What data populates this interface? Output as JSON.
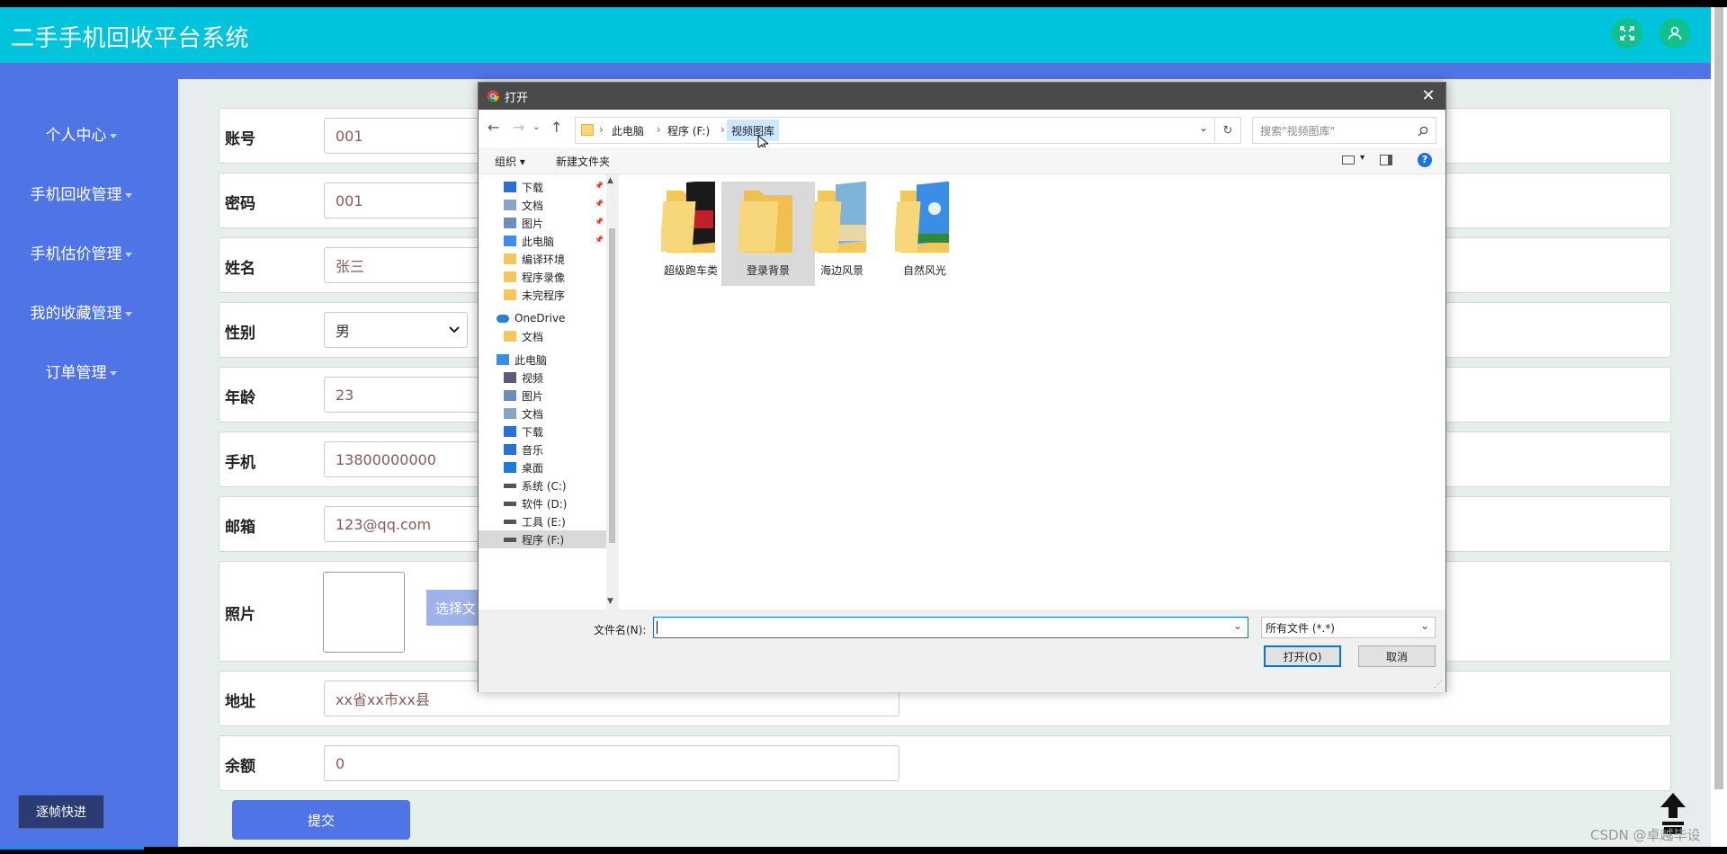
{
  "app": {
    "title": "二手手机回收平台系统"
  },
  "header": {
    "fullscreen_icon": "fullscreen-icon",
    "user_icon": "user-icon"
  },
  "sidebar": {
    "items": [
      {
        "label": "个人中心"
      },
      {
        "label": "手机回收管理"
      },
      {
        "label": "手机估价管理"
      },
      {
        "label": "我的收藏管理"
      },
      {
        "label": "订单管理"
      }
    ],
    "frame_button": "逐帧快进"
  },
  "form": {
    "fields": [
      {
        "label": "账号",
        "value": "001"
      },
      {
        "label": "密码",
        "value": "001"
      },
      {
        "label": "姓名",
        "value": "张三"
      },
      {
        "label": "性别",
        "value": "男"
      },
      {
        "label": "年龄",
        "value": "23"
      },
      {
        "label": "手机",
        "value": "13800000000"
      },
      {
        "label": "邮箱",
        "value": "123@qq.com"
      },
      {
        "label": "照片",
        "value": ""
      },
      {
        "label": "地址",
        "value": "xx省xx市xx县"
      },
      {
        "label": "余额",
        "value": "0"
      }
    ],
    "upload_button": "选择文",
    "submit_button": "提交"
  },
  "dialog": {
    "title": "打开",
    "breadcrumb": [
      "此电脑",
      "程序 (F:)",
      "视频图库"
    ],
    "search_placeholder": "搜索\"视频图库\"",
    "toolbar": {
      "organize": "组织",
      "new_folder": "新建文件夹"
    },
    "nav_pane": [
      {
        "label": "下载",
        "icon": "download-icon",
        "pinned": true
      },
      {
        "label": "文档",
        "icon": "document-icon",
        "pinned": true
      },
      {
        "label": "图片",
        "icon": "picture-icon",
        "pinned": true
      },
      {
        "label": "此电脑",
        "icon": "computer-icon",
        "pinned": true
      },
      {
        "label": "编译环境",
        "icon": "folder-icon",
        "pinned": false
      },
      {
        "label": "程序录像",
        "icon": "folder-icon",
        "pinned": false
      },
      {
        "label": "未完程序",
        "icon": "folder-icon",
        "pinned": false
      },
      {
        "label": "OneDrive",
        "icon": "cloud-icon",
        "pinned": false
      },
      {
        "label": "文档",
        "icon": "folder-icon",
        "pinned": false
      },
      {
        "label": "此电脑",
        "icon": "computer-icon",
        "pinned": false
      },
      {
        "label": "视频",
        "icon": "video-icon",
        "pinned": false
      },
      {
        "label": "图片",
        "icon": "picture-icon",
        "pinned": false
      },
      {
        "label": "文档",
        "icon": "document-icon",
        "pinned": false
      },
      {
        "label": "下载",
        "icon": "download-icon",
        "pinned": false
      },
      {
        "label": "音乐",
        "icon": "music-icon",
        "pinned": false
      },
      {
        "label": "桌面",
        "icon": "desktop-icon",
        "pinned": false
      },
      {
        "label": "系统 (C:)",
        "icon": "drive-icon",
        "pinned": false
      },
      {
        "label": "软件 (D:)",
        "icon": "drive-icon",
        "pinned": false
      },
      {
        "label": "工具 (E:)",
        "icon": "drive-icon",
        "pinned": false
      },
      {
        "label": "程序 (F:)",
        "icon": "drive-icon",
        "pinned": false
      }
    ],
    "folders": [
      {
        "label": "超级跑车类",
        "thumb": "car"
      },
      {
        "label": "登录背景",
        "thumb": "plain",
        "selected": true
      },
      {
        "label": "海边风景",
        "thumb": "beach"
      },
      {
        "label": "自然风光",
        "thumb": "sky"
      }
    ],
    "filename_label": "文件名(N):",
    "filename_value": "",
    "filter": "所有文件 (*.*)",
    "open_button": "打开(O)",
    "cancel_button": "取消"
  },
  "watermark": "CSDN @卓越毕设",
  "colors": {
    "header": "#00c4dc",
    "sidebar": "#4f74e6",
    "header_buttons": "#11c08a"
  }
}
